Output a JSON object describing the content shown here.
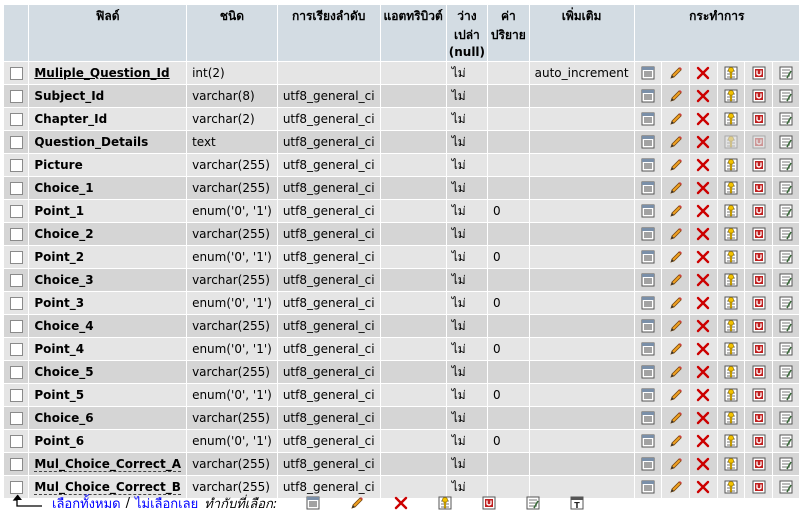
{
  "headers": {
    "field": "ฟิลด์",
    "type": "ชนิด",
    "collation": "การเรียงลำดับ",
    "attributes": "แอตทริบิวต์",
    "null_line1": "ว่าง",
    "null_line2": "เปล่า",
    "null_line3": "(null)",
    "default_line1": "ค่า",
    "default_line2": "ปริยาย",
    "extra": "เพิ่มเติม",
    "action": "กระทำการ"
  },
  "rows": [
    {
      "field": "Muliple_Question_Id",
      "type": "int(2)",
      "collation": "",
      "attributes": "",
      "null": "ไม่",
      "default": "",
      "extra": "auto_increment"
    },
    {
      "field": "Subject_Id",
      "type": "varchar(8)",
      "collation": "utf8_general_ci",
      "attributes": "",
      "null": "ไม่",
      "default": "",
      "extra": ""
    },
    {
      "field": "Chapter_Id",
      "type": "varchar(2)",
      "collation": "utf8_general_ci",
      "attributes": "",
      "null": "ไม่",
      "default": "",
      "extra": ""
    },
    {
      "field": "Question_Details",
      "type": "text",
      "collation": "utf8_general_ci",
      "attributes": "",
      "null": "ไม่",
      "default": "",
      "extra": ""
    },
    {
      "field": "Picture",
      "type": "varchar(255)",
      "collation": "utf8_general_ci",
      "attributes": "",
      "null": "ไม่",
      "default": "",
      "extra": ""
    },
    {
      "field": "Choice_1",
      "type": "varchar(255)",
      "collation": "utf8_general_ci",
      "attributes": "",
      "null": "ไม่",
      "default": "",
      "extra": ""
    },
    {
      "field": "Point_1",
      "type": "enum('0', '1')",
      "collation": "utf8_general_ci",
      "attributes": "",
      "null": "ไม่",
      "default": "0",
      "extra": ""
    },
    {
      "field": "Choice_2",
      "type": "varchar(255)",
      "collation": "utf8_general_ci",
      "attributes": "",
      "null": "ไม่",
      "default": "",
      "extra": ""
    },
    {
      "field": "Point_2",
      "type": "enum('0', '1')",
      "collation": "utf8_general_ci",
      "attributes": "",
      "null": "ไม่",
      "default": "0",
      "extra": ""
    },
    {
      "field": "Choice_3",
      "type": "varchar(255)",
      "collation": "utf8_general_ci",
      "attributes": "",
      "null": "ไม่",
      "default": "",
      "extra": ""
    },
    {
      "field": "Point_3",
      "type": "enum('0', '1')",
      "collation": "utf8_general_ci",
      "attributes": "",
      "null": "ไม่",
      "default": "0",
      "extra": ""
    },
    {
      "field": "Choice_4",
      "type": "varchar(255)",
      "collation": "utf8_general_ci",
      "attributes": "",
      "null": "ไม่",
      "default": "",
      "extra": ""
    },
    {
      "field": "Point_4",
      "type": "enum('0', '1')",
      "collation": "utf8_general_ci",
      "attributes": "",
      "null": "ไม่",
      "default": "0",
      "extra": ""
    },
    {
      "field": "Choice_5",
      "type": "varchar(255)",
      "collation": "utf8_general_ci",
      "attributes": "",
      "null": "ไม่",
      "default": "",
      "extra": ""
    },
    {
      "field": "Point_5",
      "type": "enum('0', '1')",
      "collation": "utf8_general_ci",
      "attributes": "",
      "null": "ไม่",
      "default": "0",
      "extra": ""
    },
    {
      "field": "Choice_6",
      "type": "varchar(255)",
      "collation": "utf8_general_ci",
      "attributes": "",
      "null": "ไม่",
      "default": "",
      "extra": ""
    },
    {
      "field": "Point_6",
      "type": "enum('0', '1')",
      "collation": "utf8_general_ci",
      "attributes": "",
      "null": "ไม่",
      "default": "0",
      "extra": ""
    },
    {
      "field": "Mul_Choice_Correct_A",
      "type": "varchar(255)",
      "collation": "utf8_general_ci",
      "attributes": "",
      "null": "ไม่",
      "default": "",
      "extra": ""
    },
    {
      "field": "Mul_Choice_Correct_B",
      "type": "varchar(255)",
      "collation": "utf8_general_ci",
      "attributes": "",
      "null": "ไม่",
      "default": "",
      "extra": ""
    }
  ],
  "action_icons": [
    "browse-icon",
    "edit-pencil-icon",
    "drop-x-icon",
    "primary-key-icon",
    "unique-icon",
    "index-icon"
  ],
  "footer": {
    "check_all": "เลือกทั้งหมด",
    "separator": "/",
    "uncheck_all": "ไม่เลือกเลย",
    "with_selected": "ทำกับที่เลือก:"
  },
  "colors": {
    "header_bg": "#d3dce3",
    "row_odd": "#e5e5e5",
    "row_even": "#d5d5d5",
    "link": "#0000ff",
    "drop_red": "#cc0000"
  }
}
